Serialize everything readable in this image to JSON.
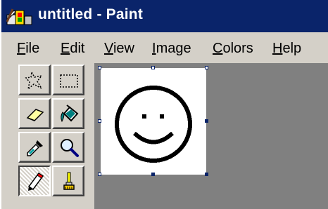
{
  "window": {
    "title": "untitled - Paint",
    "app_icon": "paint-icon"
  },
  "menu": [
    {
      "label": "File",
      "underline": "F",
      "rest": "ile"
    },
    {
      "label": "Edit",
      "underline": "E",
      "rest": "dit"
    },
    {
      "label": "View",
      "underline": "V",
      "rest": "iew"
    },
    {
      "label": "Image",
      "underline": "I",
      "rest": "mage"
    },
    {
      "label": "Colors",
      "underline": "C",
      "rest": "olors"
    },
    {
      "label": "Help",
      "underline": "H",
      "rest": "elp"
    }
  ],
  "toolbox": {
    "tools": [
      {
        "name": "free-form-select",
        "icon": "free-form-select-icon"
      },
      {
        "name": "select",
        "icon": "rectangle-select-icon"
      },
      {
        "name": "eraser",
        "icon": "eraser-icon"
      },
      {
        "name": "fill",
        "icon": "fill-bucket-icon"
      },
      {
        "name": "pick-color",
        "icon": "eyedropper-icon"
      },
      {
        "name": "magnifier",
        "icon": "magnifier-icon"
      },
      {
        "name": "pencil",
        "icon": "pencil-icon",
        "active": true
      },
      {
        "name": "brush",
        "icon": "brush-icon"
      }
    ]
  },
  "colors": {
    "titlebar": "#0a246a",
    "face": "#d4d0c8",
    "workspace": "#808080",
    "canvas": "#ffffff"
  },
  "canvas": {
    "drawing": "smiley-face"
  }
}
